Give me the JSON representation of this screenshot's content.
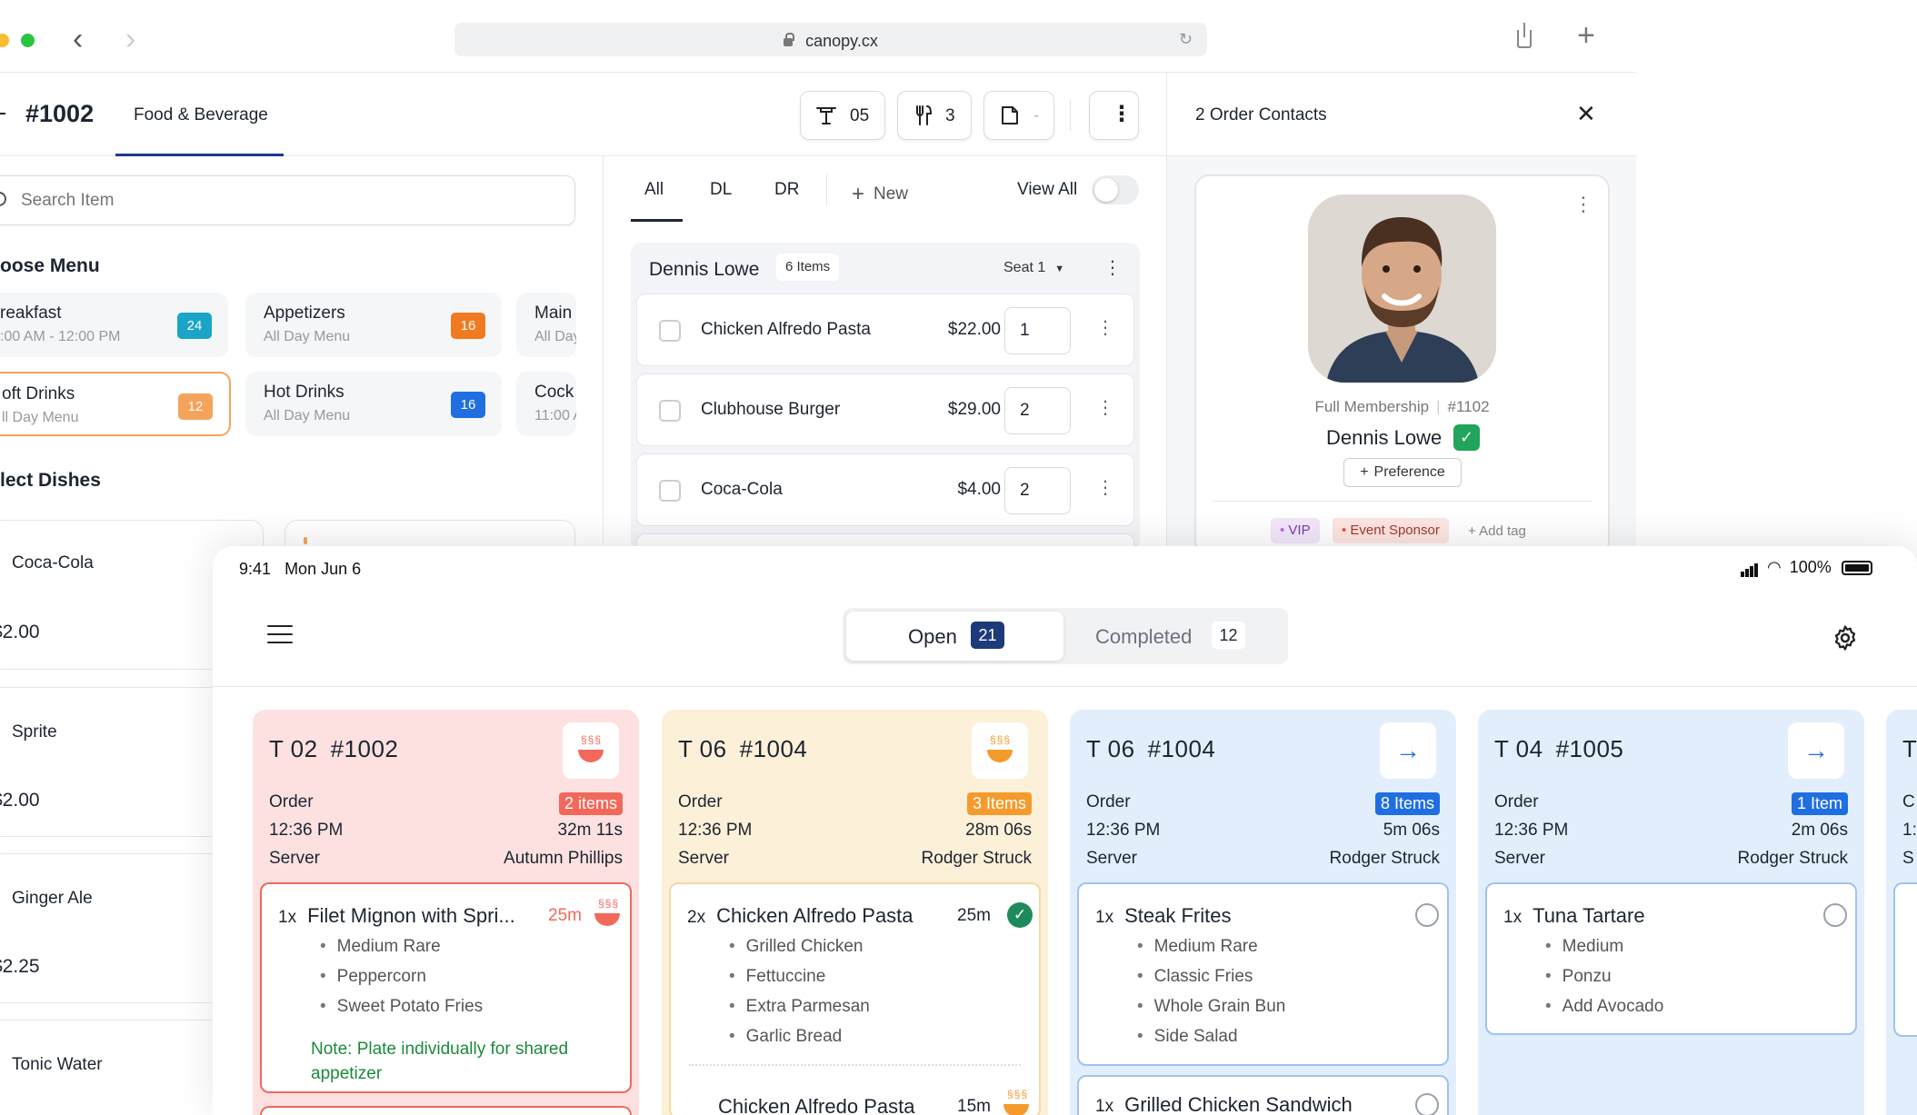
{
  "browser": {
    "url": "canopy.cx"
  },
  "order": {
    "number": "#1002",
    "tab": "Food & Beverage",
    "table_value": "05",
    "guests_value": "3",
    "notes_value": "-"
  },
  "contacts": {
    "title": "2 Order Contacts",
    "membership": "Full Membership",
    "member_id": "#1102",
    "name": "Dennis Lowe",
    "preference_label": "Preference",
    "tags": [
      "VIP",
      "Event Sponsor"
    ],
    "add_tag": "+ Add tag"
  },
  "left": {
    "search_placeholder": "Search Item",
    "choose_menu": "oose Menu",
    "select_dishes": "lect Dishes",
    "menus": [
      {
        "title": "reakfast",
        "sub": ":00 AM - 12:00 PM",
        "count": "24",
        "color": "#1aa5c8"
      },
      {
        "title": "Appetizers",
        "sub": "All Day Menu",
        "count": "16",
        "color": "#f07a22"
      },
      {
        "title": "Main",
        "sub": "All Day",
        "count": "",
        "color": ""
      },
      {
        "title": "oft Drinks",
        "sub": "ll Day Menu",
        "count": "12",
        "color": "#f4a45a"
      },
      {
        "title": "Hot Drinks",
        "sub": "All Day Menu",
        "count": "16",
        "color": "#1f6fe0"
      },
      {
        "title": "Cock",
        "sub": "11:00 A",
        "count": "",
        "color": ""
      }
    ],
    "dishes": [
      {
        "name": "Coca-Cola",
        "price": "$2.00"
      },
      {
        "name": "Sprite",
        "price": "$2.00"
      },
      {
        "name": "Ginger Ale",
        "price": "$2.25"
      },
      {
        "name": "Tonic Water",
        "price": ""
      }
    ]
  },
  "cart": {
    "tabs": [
      "All",
      "DL",
      "DR"
    ],
    "new_label": "New",
    "view_all": "View All",
    "guest": "Dennis Lowe",
    "item_count": "6 Items",
    "seat": "Seat 1",
    "items": [
      {
        "name": "Chicken Alfredo Pasta",
        "price": "$22.00",
        "qty": "1"
      },
      {
        "name": "Clubhouse Burger",
        "price": "$29.00",
        "qty": "2"
      },
      {
        "name": "Coca-Cola",
        "price": "$4.00",
        "qty": "2"
      }
    ]
  },
  "kds": {
    "time": "9:41",
    "date": "Mon Jun 6",
    "battery": "100%",
    "open_label": "Open",
    "open_count": "21",
    "completed_label": "Completed",
    "completed_count": "12",
    "tickets": [
      {
        "table": "T 02",
        "order": "#1002",
        "count": "2 items",
        "time": "12:36 PM",
        "elapsed": "32m 11s",
        "server": "Autumn Phillips",
        "bg": "#fde1e1",
        "accent": "#f2685a",
        "border": "#f2685a",
        "items": [
          {
            "qty": "1x",
            "name": "Filet Mignon with Spri...",
            "time": "25m",
            "mods": [
              "Medium Rare",
              "Peppercorn",
              "Sweet Potato Fries"
            ],
            "note": "Note: Plate individually for shared appetizer"
          }
        ]
      },
      {
        "table": "T 06",
        "order": "#1004",
        "count": "3 Items",
        "time": "12:36 PM",
        "elapsed": "28m 06s",
        "server": "Rodger Struck",
        "bg": "#fdf0d8",
        "accent": "#f59a2c",
        "border": "#f4d9a6",
        "items": [
          {
            "qty": "2x",
            "name": "Chicken Alfredo Pasta",
            "time": "25m",
            "mods": [
              "Grilled Chicken",
              "Fettuccine",
              "Extra Parmesan",
              "Garlic Bread"
            ]
          },
          {
            "qty": "",
            "name": "Chicken Alfredo Pasta",
            "time": "15m",
            "mods": []
          }
        ]
      },
      {
        "table": "T 06",
        "order": "#1004",
        "count": "8 Items",
        "time": "12:36 PM",
        "elapsed": "5m 06s",
        "server": "Rodger Struck",
        "bg": "#e3eefd",
        "accent": "#1f6fe0",
        "border": "#9fc2f2",
        "items": [
          {
            "qty": "1x",
            "name": "Steak Frites",
            "mods": [
              "Medium Rare",
              "Classic Fries",
              "Whole Grain Bun",
              "Side Salad"
            ]
          },
          {
            "qty": "1x",
            "name": "Grilled Chicken Sandwich",
            "mods": []
          }
        ]
      },
      {
        "table": "T 04",
        "order": "#1005",
        "count": "1 Item",
        "time": "12:36 PM",
        "elapsed": "2m 06s",
        "server": "Rodger Struck",
        "bg": "#e3eefd",
        "accent": "#1f6fe0",
        "border": "#9fc2f2",
        "items": [
          {
            "qty": "1x",
            "name": "Tuna Tartare",
            "mods": [
              "Medium",
              "Ponzu",
              "Add Avocado"
            ]
          }
        ]
      }
    ],
    "order_label": "Order",
    "server_label": "Server",
    "partial_ticket_title": "T",
    "partial_ticket_letters": [
      "C",
      "1:",
      "S"
    ]
  }
}
